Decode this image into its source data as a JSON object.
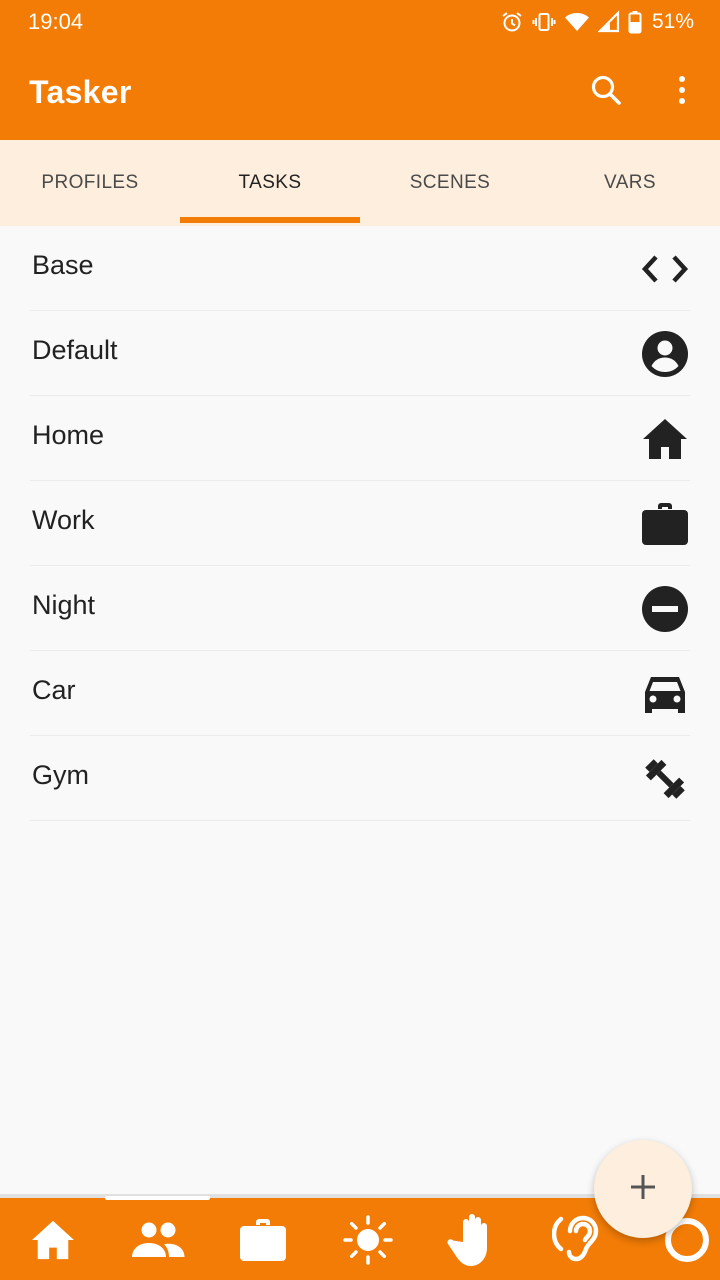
{
  "status_bar": {
    "time": "19:04",
    "battery_percent": "51%",
    "icons": [
      "alarm-icon",
      "vibrate-icon",
      "wifi-icon",
      "signal-icon",
      "battery-icon"
    ]
  },
  "app_bar": {
    "title": "Tasker",
    "actions": [
      "search-icon",
      "more-vert-icon"
    ]
  },
  "tabs": [
    {
      "label": "PROFILES",
      "active": false
    },
    {
      "label": "TASKS",
      "active": true
    },
    {
      "label": "SCENES",
      "active": false
    },
    {
      "label": "VARS",
      "active": false
    }
  ],
  "tasks": [
    {
      "label": "Base",
      "icon": "code-icon"
    },
    {
      "label": "Default",
      "icon": "account-circle-icon"
    },
    {
      "label": "Home",
      "icon": "home-icon"
    },
    {
      "label": "Work",
      "icon": "briefcase-icon"
    },
    {
      "label": "Night",
      "icon": "do-not-disturb-icon"
    },
    {
      "label": "Car",
      "icon": "car-icon"
    },
    {
      "label": "Gym",
      "icon": "dumbbell-icon"
    }
  ],
  "fab": {
    "icon": "plus-icon"
  },
  "bottom_bar": {
    "icons": [
      "home-icon",
      "people-icon",
      "briefcase-icon",
      "sun-icon",
      "hand-icon",
      "hearing-icon",
      "circle-icon"
    ]
  },
  "colors": {
    "accent": "#f27c06",
    "tab_background": "#fdeedd",
    "list_background": "#f9f9f9",
    "text": "#222222"
  }
}
